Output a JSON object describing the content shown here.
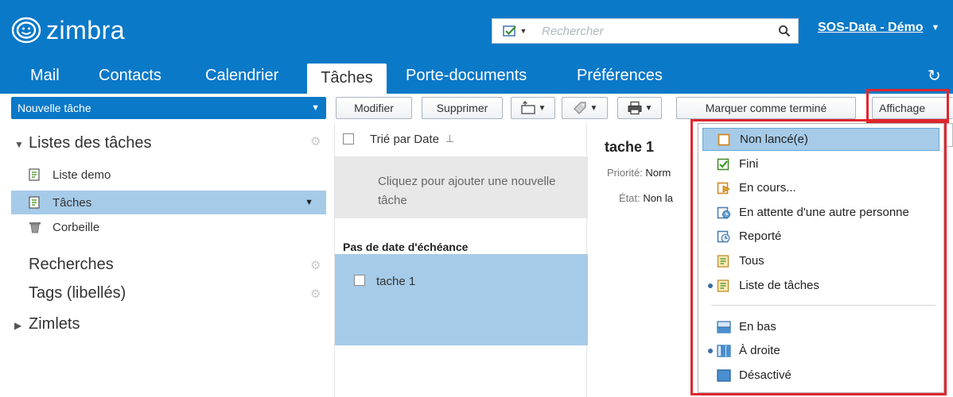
{
  "app": {
    "logo_text": "zimbra"
  },
  "search": {
    "placeholder": "Rechercher",
    "value": ""
  },
  "user": {
    "name": "SOS-Data - Démo"
  },
  "tabs": [
    {
      "label": "Mail"
    },
    {
      "label": "Contacts"
    },
    {
      "label": "Calendrier"
    },
    {
      "label": "Tâches",
      "active": true
    },
    {
      "label": "Porte-documents"
    },
    {
      "label": "Préférences"
    }
  ],
  "toolbar": {
    "new_task_label": "Nouvelle tâche",
    "edit_label": "Modifier",
    "delete_label": "Supprimer",
    "mark_done_label": "Marquer comme terminé",
    "view_label": "Affichage"
  },
  "sidebar": {
    "task_lists_header": "Listes des tâches",
    "items": [
      {
        "label": "Liste demo"
      },
      {
        "label": "Tâches",
        "selected": true
      },
      {
        "label": "Corbeille"
      }
    ],
    "searches_header": "Recherches",
    "tags_header": "Tags (libellés)",
    "zimlets_header": "Zimlets"
  },
  "list": {
    "sort_label": "Trié par Date",
    "add_placeholder": "Cliquez pour ajouter une nouvelle tâche",
    "group_label": "Pas de date d'échéance",
    "tasks": [
      {
        "name": "tache 1"
      }
    ]
  },
  "reading": {
    "title": "tache 1",
    "priority_key": "Priorité:",
    "priority_value": "Norm",
    "state_key": "État:",
    "state_value": "Non la"
  },
  "view_menu": {
    "filters": [
      {
        "label": "Non lancé(e)",
        "icon": "task-not-started-icon",
        "highlighted": true
      },
      {
        "label": "Fini",
        "icon": "task-completed-icon"
      },
      {
        "label": "En cours...",
        "icon": "task-in-progress-icon"
      },
      {
        "label": "En attente d'une autre personne",
        "icon": "task-waiting-icon"
      },
      {
        "label": "Reporté",
        "icon": "task-deferred-icon"
      },
      {
        "label": "Tous",
        "icon": "task-all-icon"
      },
      {
        "label": "Liste de tâches",
        "icon": "task-list-icon",
        "selected": true
      }
    ],
    "reading_pane": [
      {
        "label": "En bas",
        "icon": "pane-bottom-icon"
      },
      {
        "label": "À droite",
        "icon": "pane-right-icon",
        "selected": true
      },
      {
        "label": "Désactivé",
        "icon": "pane-off-icon"
      }
    ]
  },
  "colors": {
    "brand_blue": "#0a79c8",
    "selection": "#a6cbe8",
    "highlight_frame": "#e0262e"
  }
}
